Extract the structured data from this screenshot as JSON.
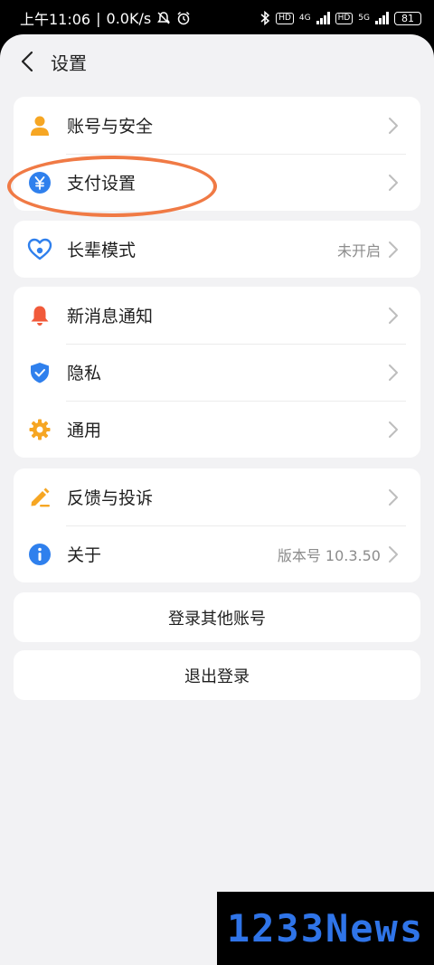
{
  "status_bar": {
    "time": "上午11:06",
    "speed": "0.0K/s",
    "net1": "4G",
    "net2": "5G",
    "hd": "HD",
    "battery": "81"
  },
  "header": {
    "title": "设置"
  },
  "groups": [
    {
      "items": [
        {
          "label": "账号与安全",
          "icon": "person-icon",
          "color": "#f6a623"
        },
        {
          "label": "支付设置",
          "icon": "yuan-icon",
          "color": "#2f80ed"
        }
      ]
    },
    {
      "items": [
        {
          "label": "长辈模式",
          "value": "未开启",
          "icon": "heart-icon",
          "color": "#2f80ed"
        }
      ]
    },
    {
      "items": [
        {
          "label": "新消息通知",
          "icon": "bell-icon",
          "color": "#f15a3a"
        },
        {
          "label": "隐私",
          "icon": "shield-icon",
          "color": "#2f80ed"
        },
        {
          "label": "通用",
          "icon": "gear-icon",
          "color": "#f6a623"
        }
      ]
    },
    {
      "items": [
        {
          "label": "反馈与投诉",
          "icon": "pen-icon",
          "color": "#f6a623"
        },
        {
          "label": "关于",
          "value": "版本号 10.3.50",
          "icon": "info-icon",
          "color": "#2f80ed"
        }
      ]
    }
  ],
  "buttons": {
    "switch_account": "登录其他账号",
    "logout": "退出登录"
  },
  "watermark": "1233News"
}
